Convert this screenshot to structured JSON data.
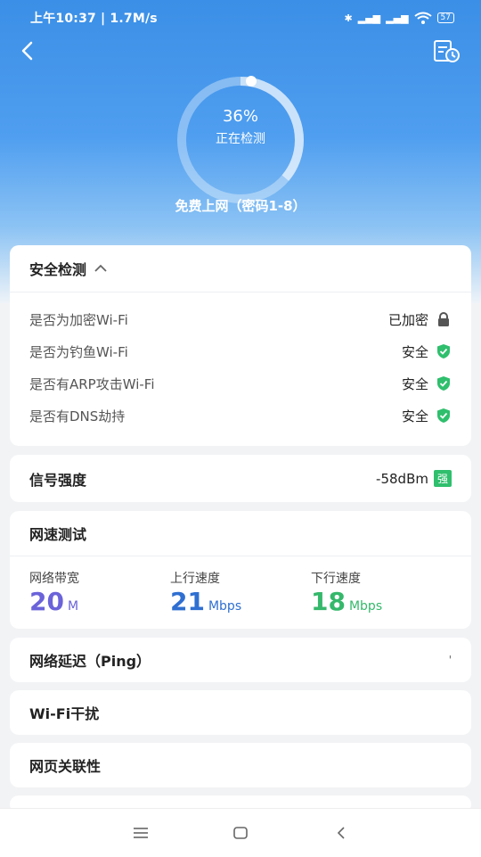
{
  "status_bar": {
    "time": "上午10:37 | 1.7M/s",
    "battery": "57"
  },
  "scan": {
    "percent": "36%",
    "state": "正在检测",
    "ssid": "免费上网（密码1-8）"
  },
  "security": {
    "title": "安全检测",
    "items": [
      {
        "label": "是否为加密Wi-Fi",
        "value": "已加密",
        "icon": "lock-icon"
      },
      {
        "label": "是否为钓鱼Wi-Fi",
        "value": "安全",
        "icon": "shield-check-icon"
      },
      {
        "label": "是否有ARP攻击Wi-Fi",
        "value": "安全",
        "icon": "shield-check-icon"
      },
      {
        "label": "是否有DNS劫持",
        "value": "安全",
        "icon": "shield-check-icon"
      }
    ]
  },
  "signal": {
    "title": "信号强度",
    "value": "-58dBm",
    "badge": "强"
  },
  "speed": {
    "title": "网速测试",
    "bandwidth": {
      "label": "网络带宽",
      "value": "20",
      "unit": "M",
      "color": "#6b63d9"
    },
    "upload": {
      "label": "上行速度",
      "value": "21",
      "unit": "Mbps",
      "color": "#2f6fd1"
    },
    "download": {
      "label": "下行速度",
      "value": "18",
      "unit": "Mbps",
      "color": "#35b86b"
    }
  },
  "sections": [
    {
      "label": "网络延迟（Ping）"
    },
    {
      "label": "Wi-Fi干扰"
    },
    {
      "label": "网页关联性"
    }
  ],
  "colors": {
    "accent_green": "#2fbf6d",
    "hero_blue": "#3b8fe6"
  }
}
